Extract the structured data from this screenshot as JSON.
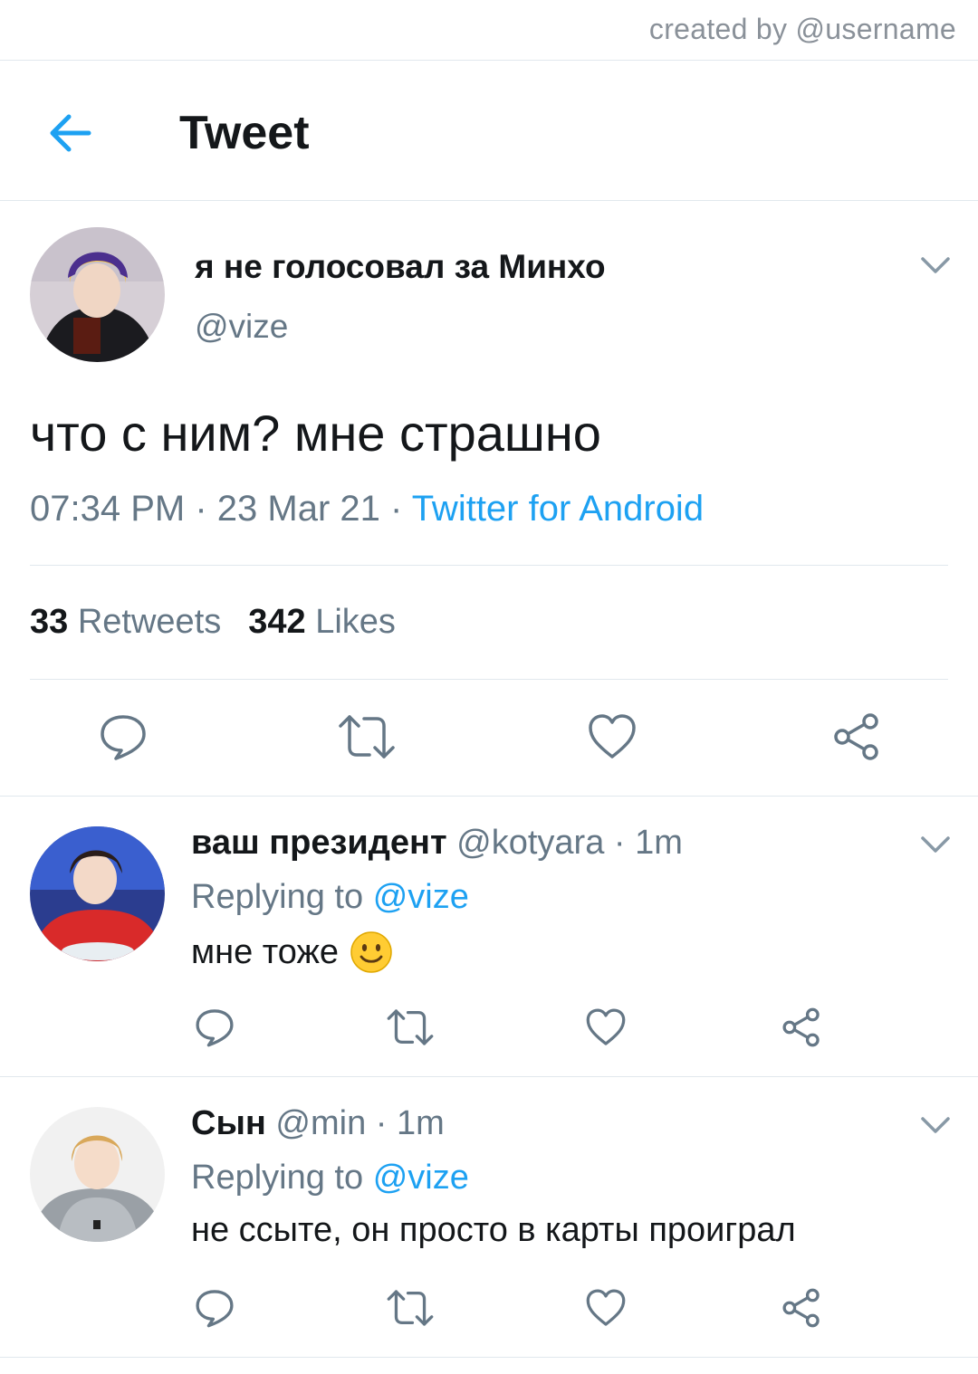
{
  "watermark": {
    "text": "created by @username"
  },
  "header": {
    "title": "Tweet",
    "back_icon": "arrow-left-icon"
  },
  "tweet": {
    "author_name": "я не голосовал за Минхо",
    "author_handle": "@vize",
    "text": "что с ним? мне страшно",
    "time": "07:34 PM",
    "date": "23 Mar 21",
    "separator": " · ",
    "source": "Twitter for Android",
    "retweets_count": "33",
    "retweets_label": "Retweets",
    "likes_count": "342",
    "likes_label": "Likes",
    "actions": [
      "reply-icon",
      "retweet-icon",
      "like-icon",
      "share-icon"
    ]
  },
  "replies": [
    {
      "name": "ваш президент",
      "handle": "@kotyara",
      "time": "1m",
      "replying_prefix": "Replying to",
      "replying_to": "@vize",
      "text": "мне тоже",
      "emoji": "slightly-smiling-face-emoji"
    },
    {
      "name": "Сын",
      "handle": "@min",
      "time": "1m",
      "replying_prefix": "Replying to",
      "replying_to": "@vize",
      "text": "не ссыте, он просто в карты проиграл"
    }
  ],
  "colors": {
    "accent": "#1da1f2",
    "text_primary": "#14171a",
    "text_secondary": "#657786",
    "divider": "#e1e8ed"
  }
}
